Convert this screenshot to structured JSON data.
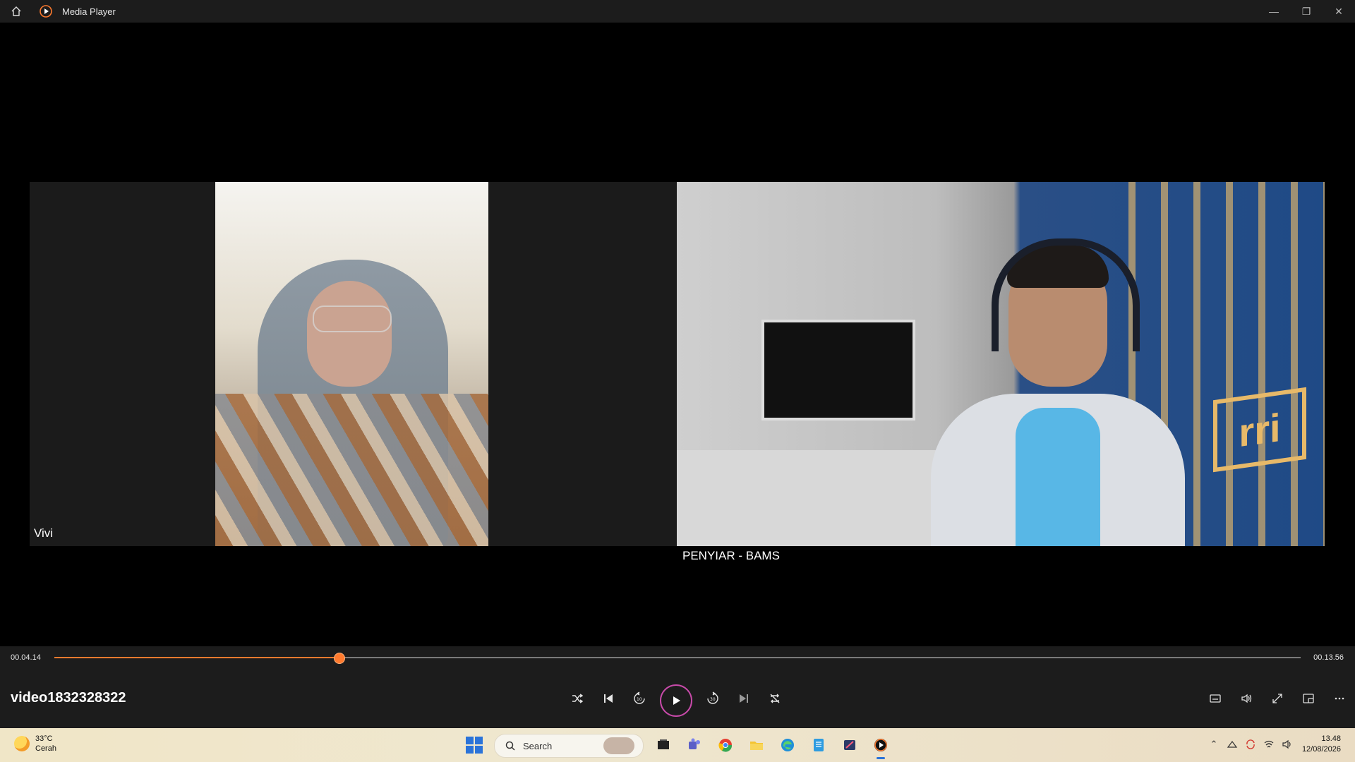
{
  "window": {
    "title": "Media Player",
    "controls": {
      "minimize": "—",
      "restore": "❐",
      "close": "✕"
    }
  },
  "video": {
    "participant_left": "Vivi",
    "participant_right": "PENYIAR - BAMS",
    "right_logo_text": "rri"
  },
  "player": {
    "current_time": "00.04.14",
    "total_time": "00.13.56",
    "progress_fraction": 0.229,
    "file_name": "video1832328322",
    "accent_color": "#ff7a2e"
  },
  "taskbar": {
    "weather_temp": "33°C",
    "weather_desc": "Cerah",
    "search_placeholder": "Search",
    "time": "13.48",
    "date": "12/08/2026"
  }
}
